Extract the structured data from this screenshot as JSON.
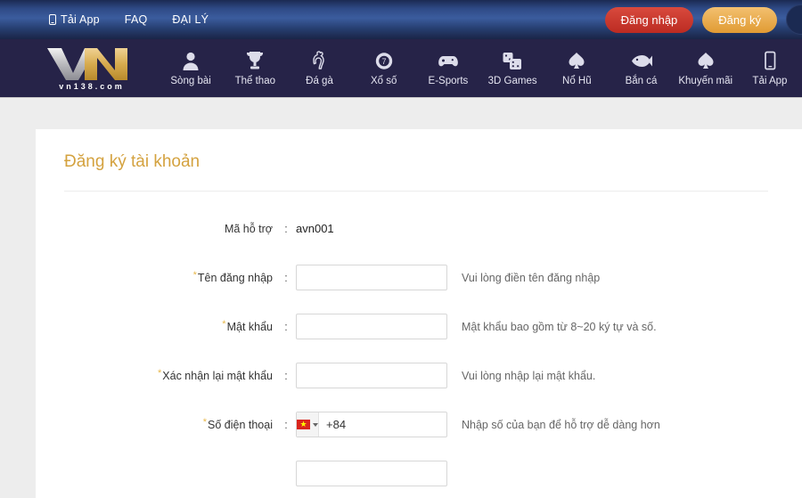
{
  "topbar": {
    "links": [
      {
        "label": "Tải App",
        "icon": "mobile-phone-icon"
      },
      {
        "label": "FAQ",
        "icon": ""
      },
      {
        "label": "ĐẠI LÝ",
        "icon": ""
      }
    ],
    "login_label": "Đăng nhập",
    "register_label": "Đăng ký",
    "login_color": "#c3362b",
    "register_color": "#e7a53f"
  },
  "nav": {
    "logo_text": "VN",
    "logo_sub": "vn138.com",
    "items": [
      {
        "label": "Sòng bài",
        "icon": "person-icon"
      },
      {
        "label": "Thể thao",
        "icon": "trophy-icon"
      },
      {
        "label": "Đá gà",
        "icon": "rooster-icon"
      },
      {
        "label": "Xổ số",
        "icon": "lottery-ball-icon"
      },
      {
        "label": "E-Sports",
        "icon": "gamepad-icon"
      },
      {
        "label": "3D Games",
        "icon": "dice-icon"
      },
      {
        "label": "Nổ Hũ",
        "icon": "spade-icon"
      },
      {
        "label": "Bắn cá",
        "icon": "fish-icon"
      },
      {
        "label": "Khuyến mãi",
        "icon": "spade-icon"
      },
      {
        "label": "Tải App",
        "icon": "mobile-phone-icon"
      }
    ]
  },
  "card": {
    "title": "Đăng ký tài khoản",
    "title_color": "#d4a23f"
  },
  "form": {
    "support_code": {
      "label": "Mã hỗ trợ",
      "colon": ":",
      "value": "avn001"
    },
    "rows": [
      {
        "label": "Tên đăng nhập",
        "colon": ":",
        "required": "*",
        "value": "",
        "placeholder": "",
        "hint": "Vui lòng điền tên đăng nhập"
      },
      {
        "label": "Mật khẩu",
        "colon": ":",
        "required": "*",
        "value": "",
        "placeholder": "",
        "hint": "Mật khẩu bao gồm từ 8~20 ký tự và số."
      },
      {
        "label": "Xác nhận lại mật khẩu",
        "colon": ":",
        "required": "*",
        "value": "",
        "placeholder": "",
        "hint": "Vui lòng nhập lại mật khẩu."
      }
    ],
    "phone_row": {
      "label": "Số điện thoại",
      "colon": ":",
      "required": "*",
      "country_flag": "vietnam-flag",
      "value": "+84",
      "placeholder": "",
      "hint": "Nhập số của bạn để hỗ trợ dễ dàng hơn"
    }
  }
}
